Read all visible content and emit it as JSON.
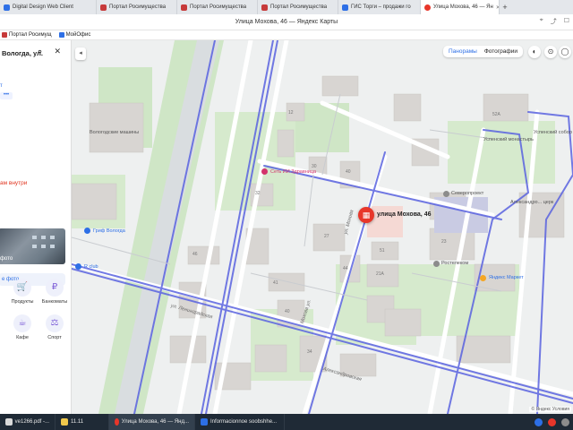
{
  "browser": {
    "tabs": [
      {
        "label": "Digital Design Web Client",
        "color": "#2d6fe6"
      },
      {
        "label": "Портал Росимущества",
        "color": "#c73a3a"
      },
      {
        "label": "Портал Росимущества",
        "color": "#c73a3a"
      },
      {
        "label": "Портал Росимущества",
        "color": "#c73a3a"
      },
      {
        "label": "ГИС Торги – продажи го",
        "color": "#2d6fe6"
      },
      {
        "label": "Улица Мохова, 46 — Ян",
        "color": "#e8362a"
      }
    ],
    "page_title": "Улица Мохова, 46 — Яндекс Карты",
    "bookmarks": [
      "Портал Росимущ",
      "МойОфис"
    ]
  },
  "sidebar": {
    "search_value": "Вологда, ул.",
    "link_text": "т",
    "badge": "•••",
    "red_text": "ам внутри",
    "photo_label": "фото",
    "photo_button": "е фото",
    "categories": [
      {
        "label": "Продукты",
        "icon": "🛒"
      },
      {
        "label": "Банкоматы",
        "icon": "₽"
      },
      {
        "label": "Кафе",
        "icon": "☕"
      },
      {
        "label": "Спорт",
        "icon": "⚖"
      }
    ]
  },
  "map": {
    "mode_panoramas": "Панорамы",
    "mode_photos": "Фотографии",
    "marker_label": "улица Мохова, 46",
    "pois": [
      {
        "label": "Вологодские машины"
      },
      {
        "label": "Гриф Вологда"
      },
      {
        "label": "Сеть ИИ Здравница"
      },
      {
        "label": "Северопроект"
      },
      {
        "label": "Ростелеком"
      },
      {
        "label": "Яндекс Маркет"
      },
      {
        "label": "Успенский собор"
      },
      {
        "label": "Успенский монастырь"
      },
      {
        "label": "Александро... церк"
      },
      {
        "label": "R club"
      }
    ],
    "streets": [
      "ул. Мохова",
      "Мохова ул.",
      "ул. Ленинградская",
      "Александровская"
    ],
    "attribution": "© Яндекс Условия"
  },
  "taskbar": {
    "items": [
      {
        "label": "ve1266.pdf -...",
        "color": "#d9d9d9"
      },
      {
        "label": "11.11",
        "color": "#f2c94c"
      },
      {
        "label": "Улица Мохова, 46 — Янд...",
        "color": "#e8362a"
      },
      {
        "label": "Informacionnoe soobshhe...",
        "color": "#2d6fe6"
      }
    ]
  }
}
